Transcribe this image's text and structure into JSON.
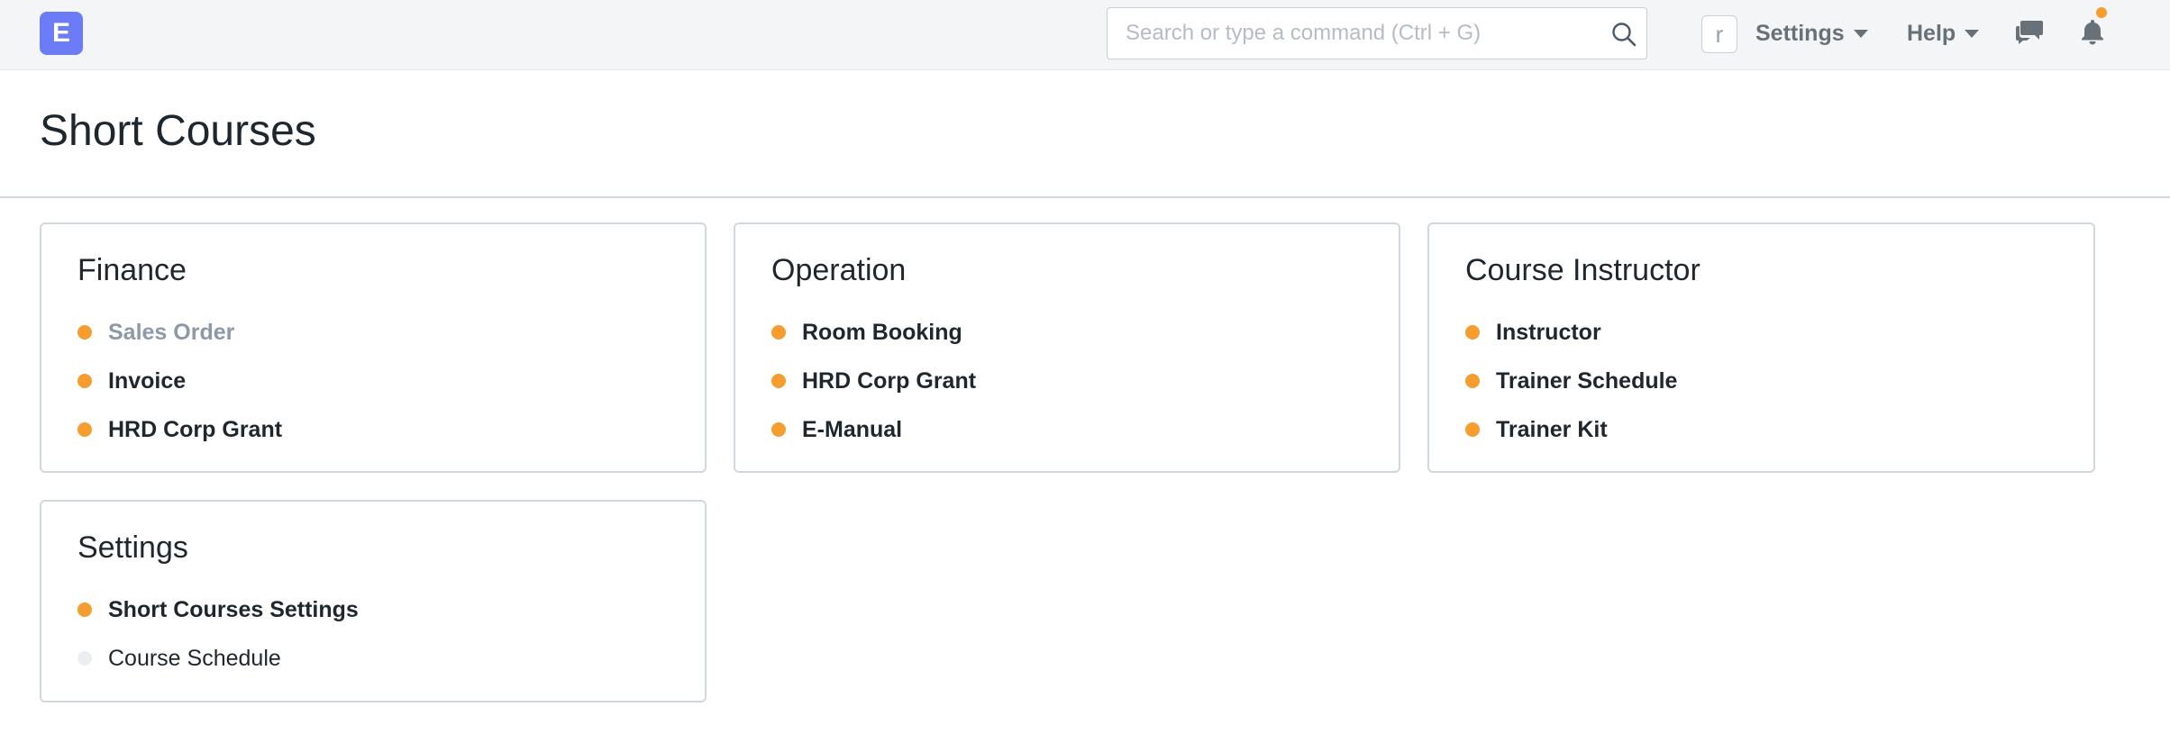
{
  "navbar": {
    "logo_letter": "E",
    "search_placeholder": "Search or type a command (Ctrl + G)",
    "avatar_letter": "r",
    "settings_label": "Settings",
    "help_label": "Help"
  },
  "page": {
    "title": "Short Courses"
  },
  "cards": [
    {
      "title": "Finance",
      "links": [
        {
          "label": "Sales Order",
          "status": "disabled"
        },
        {
          "label": "Invoice",
          "status": "active"
        },
        {
          "label": "HRD Corp Grant",
          "status": "active"
        }
      ]
    },
    {
      "title": "Operation",
      "links": [
        {
          "label": "Room Booking",
          "status": "active"
        },
        {
          "label": "HRD Corp Grant",
          "status": "active"
        },
        {
          "label": "E-Manual",
          "status": "active"
        }
      ]
    },
    {
      "title": "Course Instructor",
      "links": [
        {
          "label": "Instructor",
          "status": "active"
        },
        {
          "label": "Trainer Schedule",
          "status": "active"
        },
        {
          "label": "Trainer Kit",
          "status": "active"
        }
      ]
    },
    {
      "title": "Settings",
      "links": [
        {
          "label": "Short Courses Settings",
          "status": "active"
        },
        {
          "label": "Course Schedule",
          "status": "inactive"
        }
      ]
    }
  ],
  "colors": {
    "logo_bg": "#6c7cf7",
    "indicator_active": "#f59d2f",
    "indicator_inactive": "#ebeef0",
    "notification_dot": "#f79c2f"
  }
}
